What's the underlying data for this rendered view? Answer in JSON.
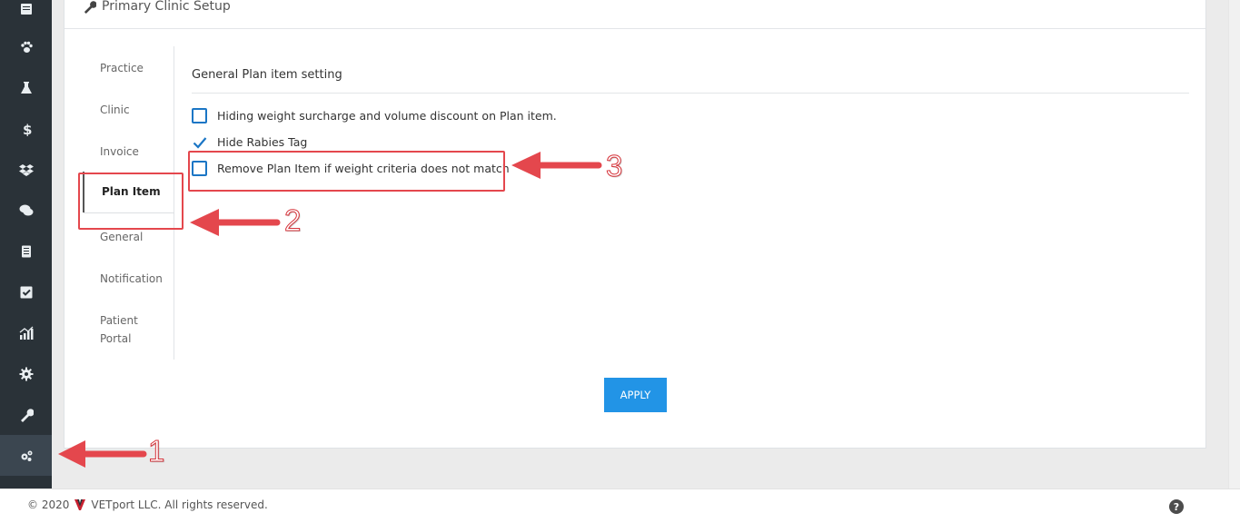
{
  "card": {
    "title": "Primary Clinic Setup"
  },
  "tabs": [
    {
      "label": "Practice"
    },
    {
      "label": "Clinic"
    },
    {
      "label": "Invoice"
    },
    {
      "label": "Plan Item"
    },
    {
      "label": "General"
    },
    {
      "label": "Notification"
    },
    {
      "label": "Patient Portal"
    }
  ],
  "content": {
    "section_title": "General Plan item setting",
    "options": [
      {
        "label": "Hiding weight surcharge and volume discount on Plan item.",
        "checked": false
      },
      {
        "label": "Hide Rabies Tag",
        "checked": true
      },
      {
        "label": "Remove Plan Item if weight criteria does not match",
        "checked": false
      }
    ],
    "apply_label": "APPLY"
  },
  "annotations": {
    "one": "1",
    "two": "2",
    "three": "3"
  },
  "footer": {
    "copyright": "© 2020",
    "company": "VETport LLC. All rights reserved.",
    "help": "?"
  },
  "sidebar_icons": [
    "calendar-icon",
    "paw-icon",
    "flask-icon",
    "dollar-icon",
    "dropbox-icon",
    "chat-icon",
    "document-icon",
    "checkbox-icon",
    "chart-icon",
    "gear-icon",
    "wrench-icon",
    "gears-icon"
  ],
  "colors": {
    "accent": "#2294e6",
    "annotation": "#e4474d",
    "sidebar": "#2a3238",
    "checkbox": "#1b76c5"
  }
}
